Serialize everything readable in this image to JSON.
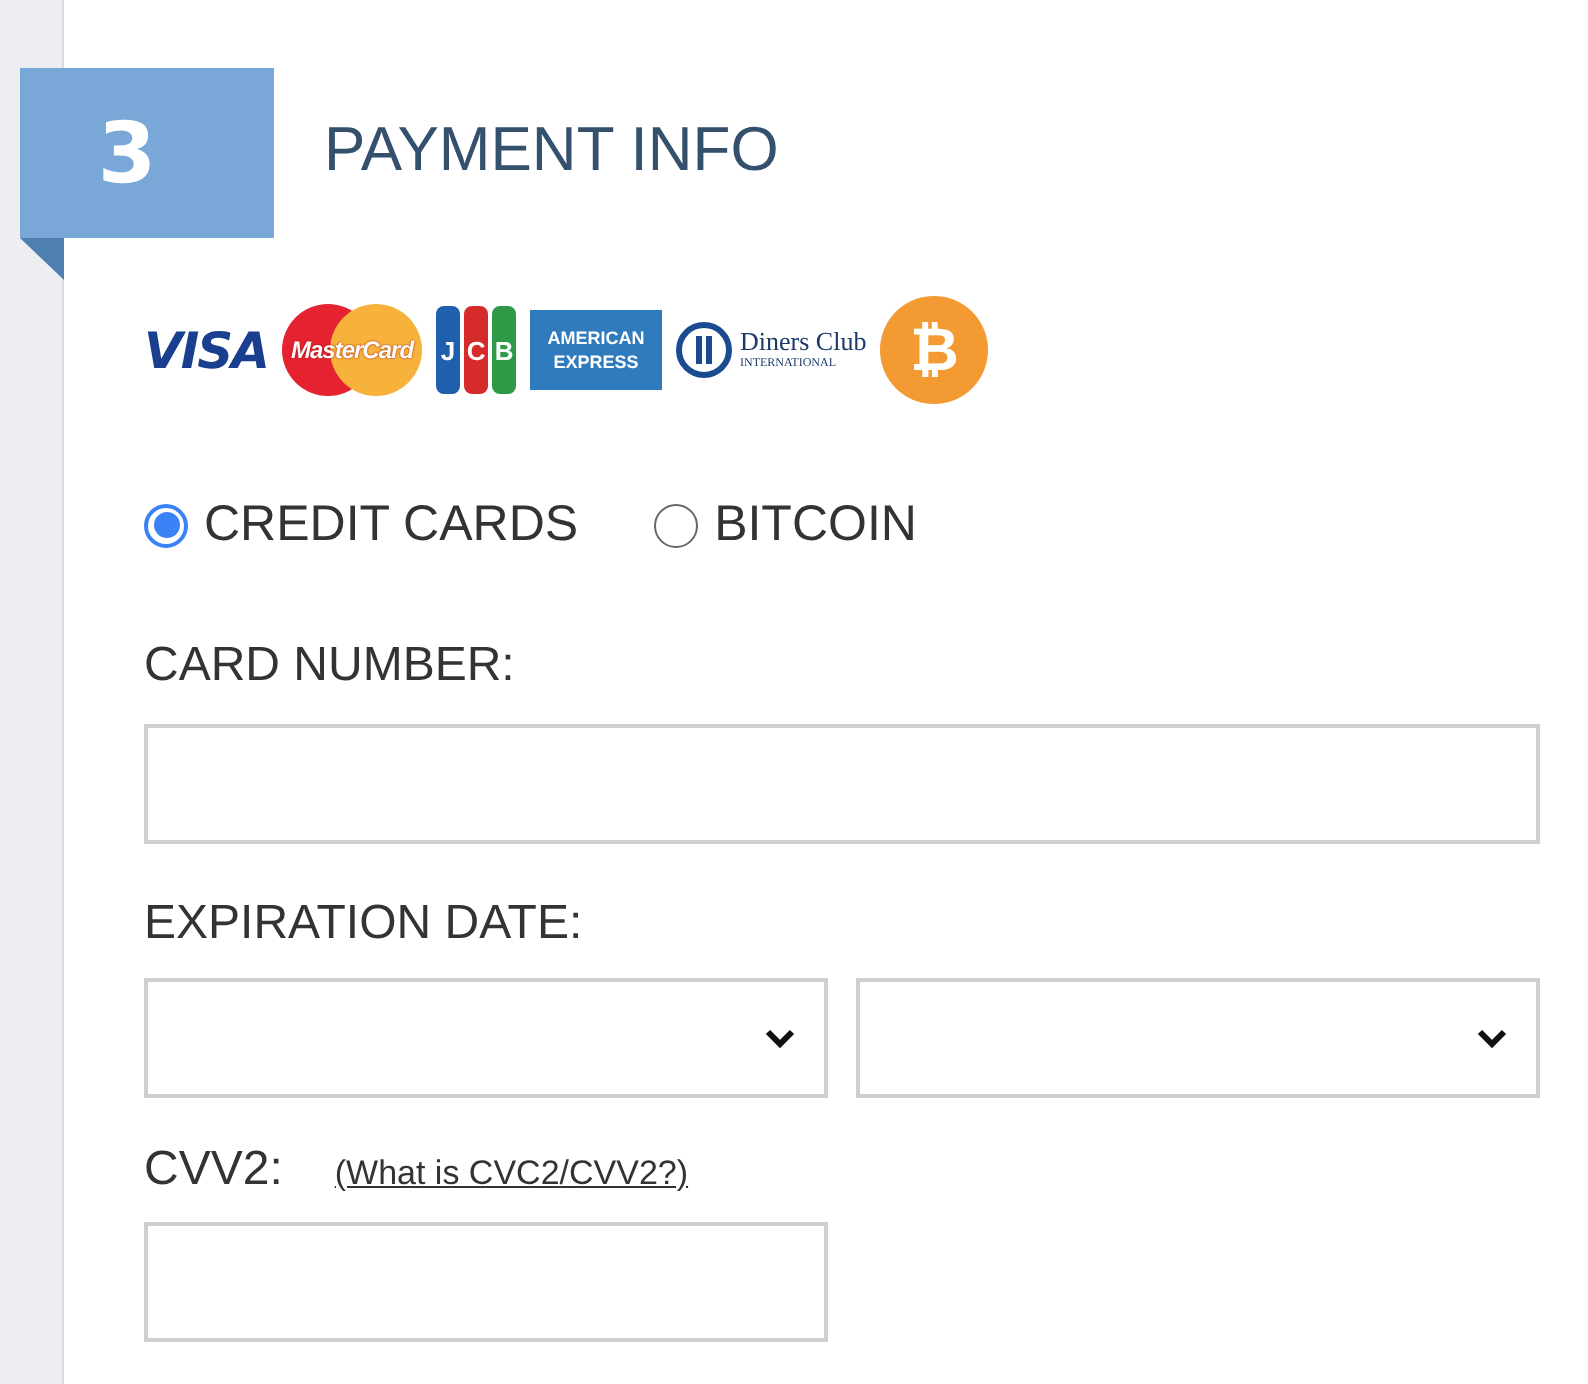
{
  "step": {
    "number": "3",
    "title": "PAYMENT INFO"
  },
  "card_logos": [
    {
      "kind": "visa",
      "lines": [
        "VISA"
      ]
    },
    {
      "kind": "mastercard",
      "lines": [
        "MasterCard"
      ]
    },
    {
      "kind": "jcb",
      "lines": [
        "J",
        "C",
        "B"
      ]
    },
    {
      "kind": "amex",
      "lines": [
        "AMERICAN",
        "EXPRESS"
      ]
    },
    {
      "kind": "diners",
      "lines": [
        "Diners Club",
        "INTERNATIONAL"
      ]
    },
    {
      "kind": "bitcoin",
      "lines": [
        "₿"
      ]
    }
  ],
  "payment_methods": [
    {
      "label": "CREDIT CARDS",
      "selected": true
    },
    {
      "label": "BITCOIN",
      "selected": false
    }
  ],
  "card_number": {
    "label": "CARD NUMBER:"
  },
  "expiration_date": {
    "label": "EXPIRATION DATE:"
  },
  "cvv2": {
    "label": "CVV2:",
    "help_link": "(What is CVC2/CVV2?)"
  }
}
